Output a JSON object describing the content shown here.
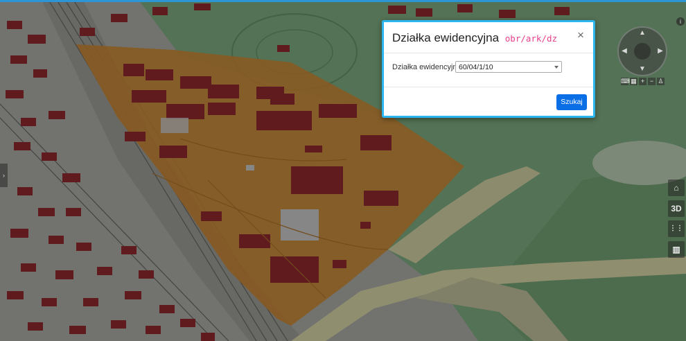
{
  "modal": {
    "title": "Działka ewidencyjna",
    "title_code": "obr/ark/dz",
    "close_label": "×",
    "field_label": "Działka ewidencyjna",
    "field_value": "60/04/1/10",
    "search_label": "Szukaj"
  },
  "controls": {
    "home_label": "⌂",
    "threed_label": "3D",
    "grid_label": "⋮⋮",
    "map_label": "▥",
    "info_label": "i",
    "side_handle_label": "›",
    "compass_center": "◉",
    "zoom_in": "+",
    "zoom_out": "−"
  },
  "colors": {
    "highlight_area": "#d9923a",
    "modal_border": "#2bb6f0",
    "button_primary": "#0a6fe6",
    "building_roof": "#9b2d33"
  }
}
